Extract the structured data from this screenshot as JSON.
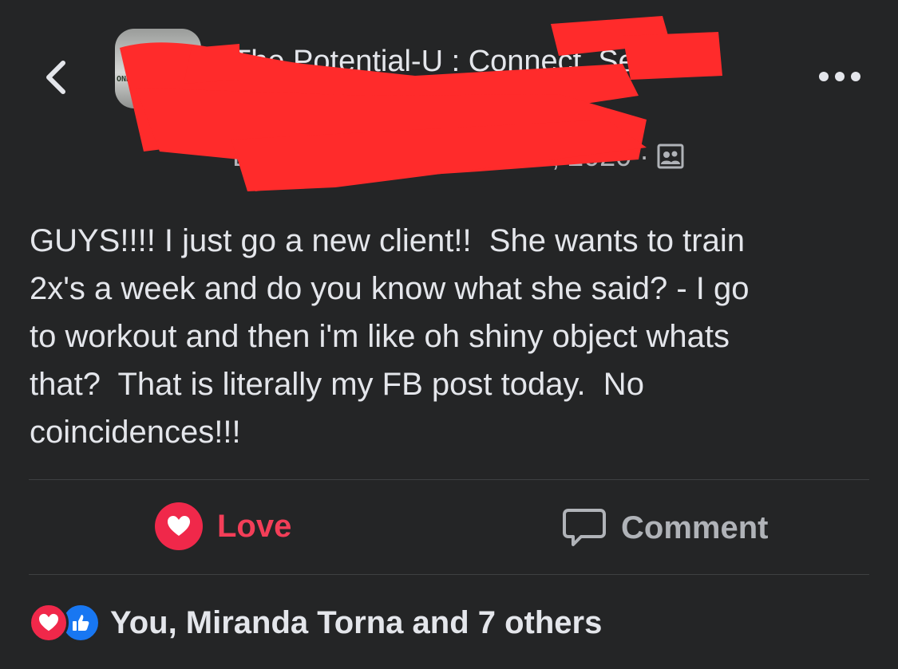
{
  "header": {
    "group_title": "The Potential-U : Connect, Serve, Grow",
    "author_name": "B",
    "date": "Oct 26, 2020",
    "separator": "·"
  },
  "post": {
    "text": "GUYS!!!! I just go a new client!!  She wants to train\n2x's a week and do you know what she said? - I go\nto workout and then i'm like oh shiny object whats\nthat?  That is literally my FB post today.  No\ncoincidences!!!"
  },
  "actions": {
    "love_label": "Love",
    "comment_label": "Comment"
  },
  "reactions": {
    "summary": "You, Miranda Torna and 7 others"
  },
  "avatar": {
    "text": "ONN"
  },
  "colors": {
    "background": "#242526",
    "love": "#f33e58",
    "like": "#1877f2",
    "redaction": "#ff2b2b"
  }
}
